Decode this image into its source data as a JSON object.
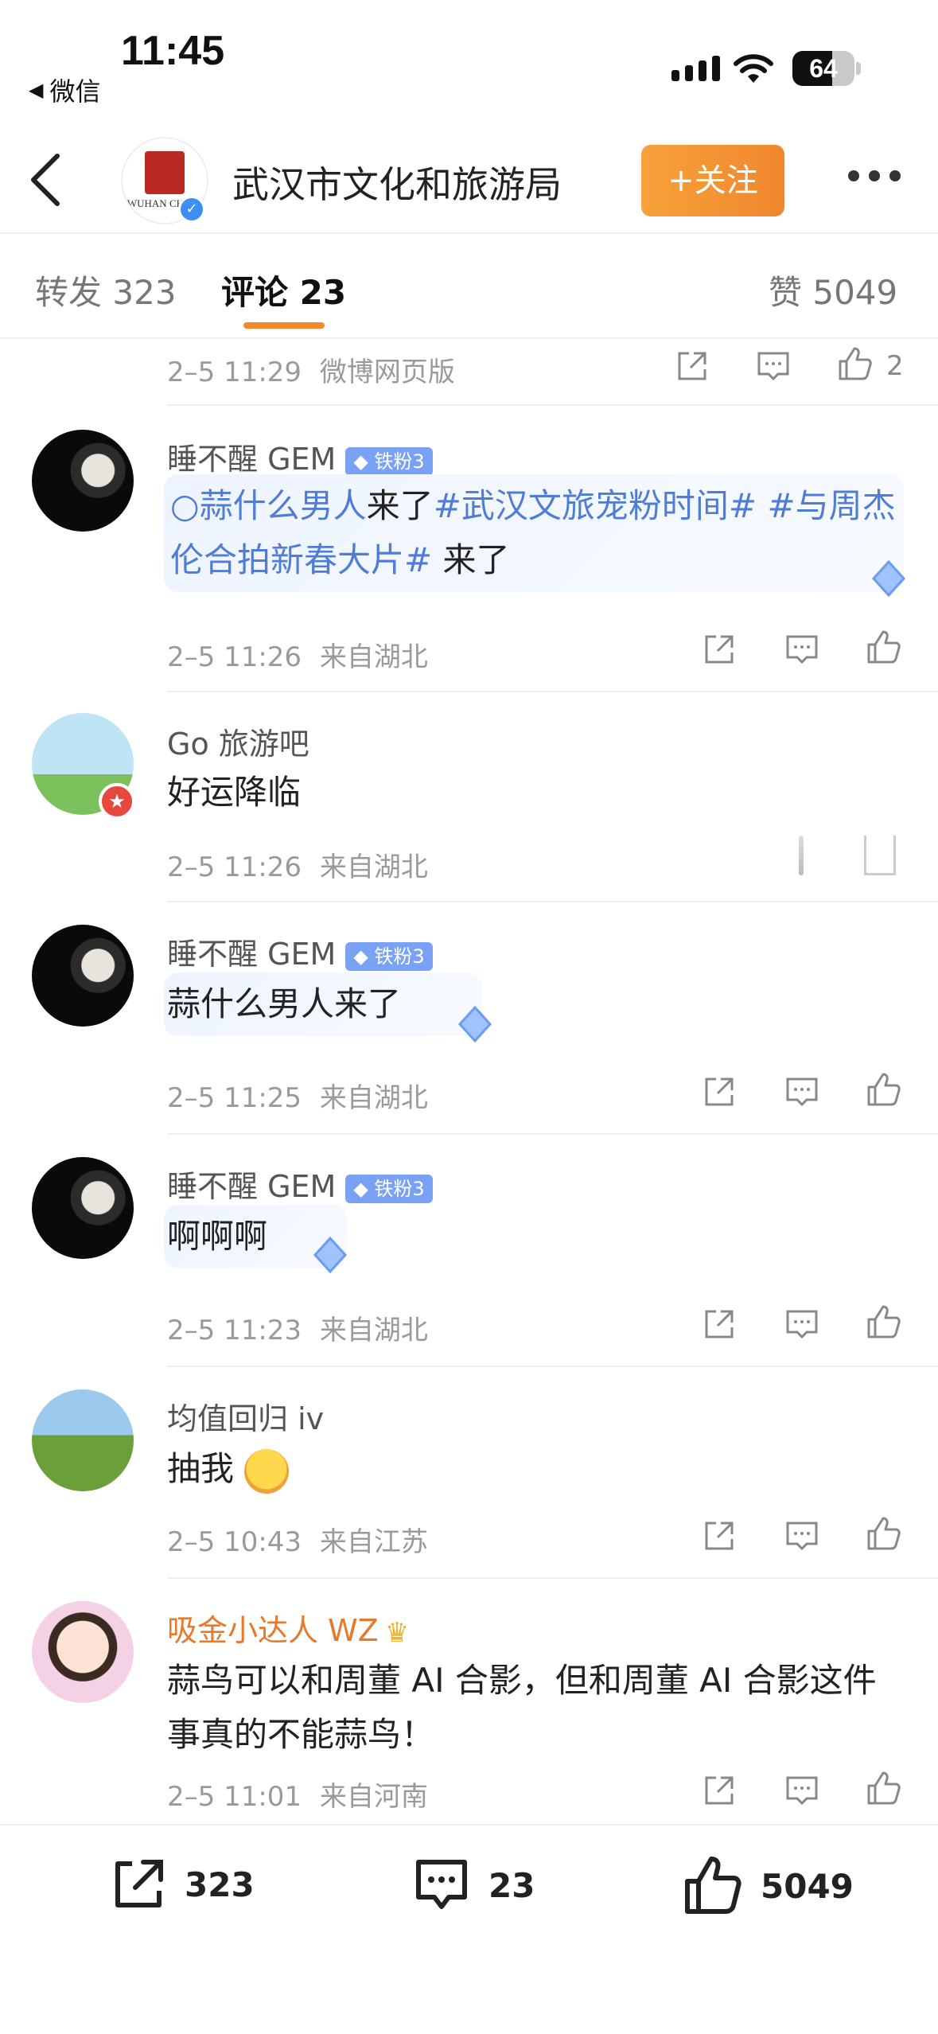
{
  "status_bar": {
    "time": "11:45",
    "back_app": "微信",
    "battery": "64",
    "battery_level": 0.64
  },
  "header": {
    "title": "武汉市文化和旅游局",
    "logo_text": "WUHAN CHINA",
    "follow_label": "+关注"
  },
  "tabs": {
    "repost": "转发 323",
    "comment": "评论 23",
    "like": "赞 5049"
  },
  "top_meta": {
    "time": "2–5 11:29",
    "source": "微博网页版",
    "likes": "2"
  },
  "comments": [
    {
      "user": "睡不醒 GEM",
      "badge": "铁粉3",
      "text_parts": [
        "蒜什么男人",
        "来了",
        "#武汉文旅宠粉时间#",
        " ",
        "#与周杰伦合拍新春大片#",
        " 来了"
      ],
      "time": "2–5 11:26",
      "location": "来自湖北"
    },
    {
      "user": "Go 旅游吧",
      "text": "好运降临",
      "time": "2–5 11:26",
      "location": "来自湖北"
    },
    {
      "user": "睡不醒 GEM",
      "badge": "铁粉3",
      "text": "蒜什么男人来了",
      "time": "2–5 11:25",
      "location": "来自湖北"
    },
    {
      "user": "睡不醒 GEM",
      "badge": "铁粉3",
      "text": "啊啊啊",
      "time": "2–5 11:23",
      "location": "来自湖北"
    },
    {
      "user": "均值回归 iv",
      "text": "抽我",
      "time": "2–5 10:43",
      "location": "来自江苏"
    },
    {
      "user": "吸金小达人 WZ",
      "text_lines": [
        "蒜鸟可以和周董 AI 合影，但和周董 AI 合影这件",
        "事真的不能蒜鸟！"
      ],
      "time": "2–5 11:01",
      "location": "来自河南"
    }
  ],
  "bottom_bar": {
    "reposts": "323",
    "comments": "23",
    "likes": "5049"
  },
  "colors": {
    "accent": "#f28a2c",
    "topic": "#4f7dd6",
    "fan_badge": "#7aa2f4",
    "verify": "#3d8ef5"
  }
}
